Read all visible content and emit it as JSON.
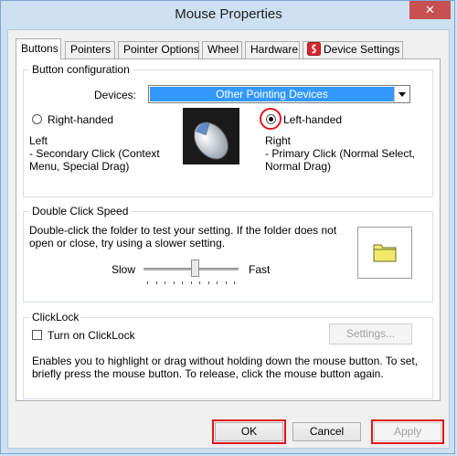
{
  "window": {
    "title": "Mouse Properties",
    "close_glyph": "✕"
  },
  "tabs": [
    {
      "label": "Buttons"
    },
    {
      "label": "Pointers"
    },
    {
      "label": "Pointer Options"
    },
    {
      "label": "Wheel"
    },
    {
      "label": "Hardware"
    },
    {
      "label": "Device Settings"
    }
  ],
  "button_config": {
    "legend": "Button configuration",
    "devices_label": "Devices:",
    "devices_value": "Other Pointing Devices",
    "right_handed_label": "Right-handed",
    "left_handed_label": "Left-handed",
    "selected": "left-handed",
    "left_title": "Left",
    "left_desc": " - Secondary Click (Context Menu, Special Drag)",
    "right_title": "Right",
    "right_desc": " - Primary Click (Normal Select, Normal Drag)"
  },
  "double_click": {
    "legend": "Double Click Speed",
    "instructions": "Double-click the folder to test your setting.  If the folder does not open or close, try using a slower setting.",
    "slow_label": "Slow",
    "fast_label": "Fast",
    "speed_fraction": 0.55
  },
  "clicklock": {
    "legend": "ClickLock",
    "checkbox_label": "Turn on ClickLock",
    "checked": false,
    "settings_label": "Settings...",
    "description": "Enables you to highlight or drag without holding down the mouse button.  To set, briefly press the mouse button.  To release, click the mouse button again."
  },
  "footer": {
    "ok_label": "OK",
    "cancel_label": "Cancel",
    "apply_label": "Apply"
  },
  "colors": {
    "highlight": "#e0141e",
    "selection": "#3399ff",
    "folder": "#f0ea6a"
  }
}
